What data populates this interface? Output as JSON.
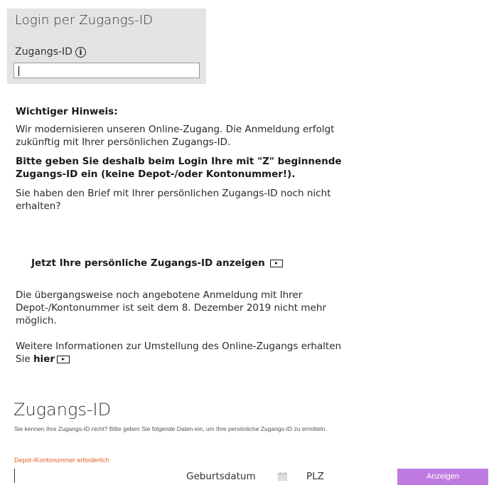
{
  "login": {
    "title": "Login per Zugangs-ID",
    "id_label": "Zugangs-ID",
    "id_input_value": "",
    "info_icon": "info-circle-icon"
  },
  "notice": {
    "heading": "Wichtiger Hinweis:",
    "p1": "Wir modernisieren unseren Online-Zugang. Die Anmeldung erfolgt zukünftig mit Ihrer persönlichen Zugangs-ID.",
    "p2": "Bitte geben Sie deshalb beim Login Ihre mit \"Z\" beginnende Zugangs-ID ein (keine Depot-/oder Kontonummer!).",
    "p3": "Sie haben den Brief mit Ihrer persönlichen Zugangs-ID noch nicht erhalten?",
    "show_id_link": "Jetzt Ihre persönliche Zugangs-ID anzeigen",
    "p4": "Die übergangsweise noch angebotene Anmeldung mit Ihrer Depot-/Kontonummer ist seit dem 8. Dezember 2019 nicht mehr möglich.",
    "p5_prefix": "Weitere Informationen zur Umstellung des Online-Zugangs erhalten Sie",
    "p5_link": "hier"
  },
  "lookup": {
    "title": "Zugangs-ID",
    "subtitle": "Sie kennen Ihre Zugangs-ID nicht? Bitte geben Sie folgende Daten ein, um Ihre persönliche Zugangs-ID zu ermitteln.",
    "error": "Depot-/Kontonummer erforderlich",
    "birthdate_label": "Geburtsdatum",
    "plz_label": "PLZ",
    "submit_label": "Anzeigen",
    "calendar_icon": "calendar-icon"
  },
  "colors": {
    "panel_bg": "#e3e3e3",
    "error": "#e2632b",
    "button_bg": "#c07be2"
  }
}
